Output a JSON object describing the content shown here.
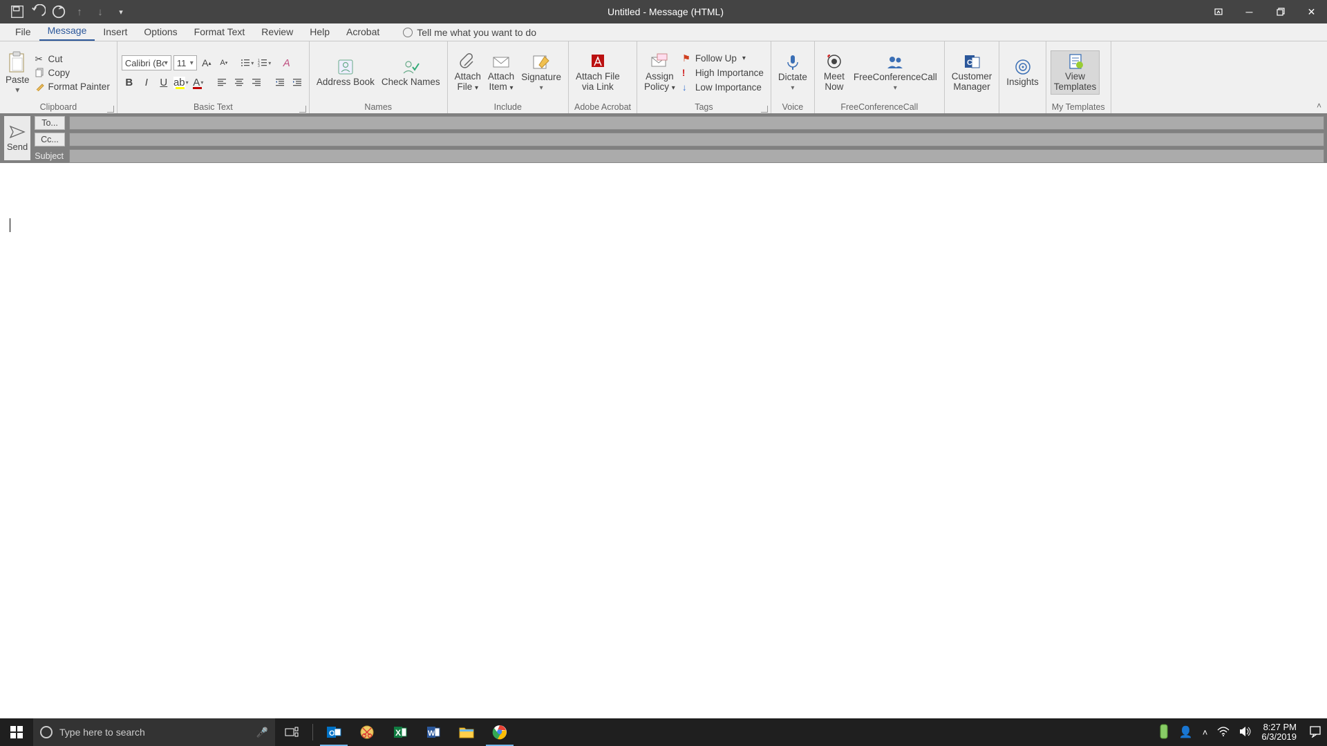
{
  "title": "Untitled  -  Message (HTML)",
  "qat": {
    "save": "save-icon",
    "undo": "undo-icon",
    "redo": "redo-icon",
    "prev": "prev-icon",
    "next": "next-icon",
    "custom": "customize-icon"
  },
  "tabs": {
    "file": "File",
    "message": "Message",
    "insert": "Insert",
    "options": "Options",
    "format_text": "Format Text",
    "review": "Review",
    "help": "Help",
    "acrobat": "Acrobat",
    "tellme": "Tell me what you want to do"
  },
  "ribbon": {
    "clipboard": {
      "label": "Clipboard",
      "paste": "Paste",
      "cut": "Cut",
      "copy": "Copy",
      "format_painter": "Format Painter"
    },
    "basic_text": {
      "label": "Basic Text",
      "font": "Calibri (Boc",
      "size": "11"
    },
    "names": {
      "label": "Names",
      "address_book": "Address Book",
      "check_names": "Check Names"
    },
    "include": {
      "label": "Include",
      "attach_file": "Attach File",
      "attach_item": "Attach Item",
      "signature": "Signature"
    },
    "adobe": {
      "label": "Adobe Acrobat",
      "attach_link": "Attach File via Link"
    },
    "tags": {
      "label": "Tags",
      "assign_policy": "Assign Policy",
      "follow_up": "Follow Up",
      "high": "High Importance",
      "low": "Low Importance"
    },
    "voice": {
      "label": "Voice",
      "dictate": "Dictate"
    },
    "fcc": {
      "label": "FreeConferenceCall",
      "meet_now": "Meet Now",
      "fcc": "FreeConferenceCall"
    },
    "cm": {
      "customer_manager": "Customer Manager"
    },
    "insights": {
      "insights": "Insights"
    },
    "templates": {
      "label": "My Templates",
      "view_templates": "View Templates"
    }
  },
  "address": {
    "send": "Send",
    "to": "To...",
    "cc": "Cc...",
    "subject": "Subject"
  },
  "taskbar": {
    "search_placeholder": "Type here to search",
    "time": "8:27 PM",
    "date": "6/3/2019"
  }
}
